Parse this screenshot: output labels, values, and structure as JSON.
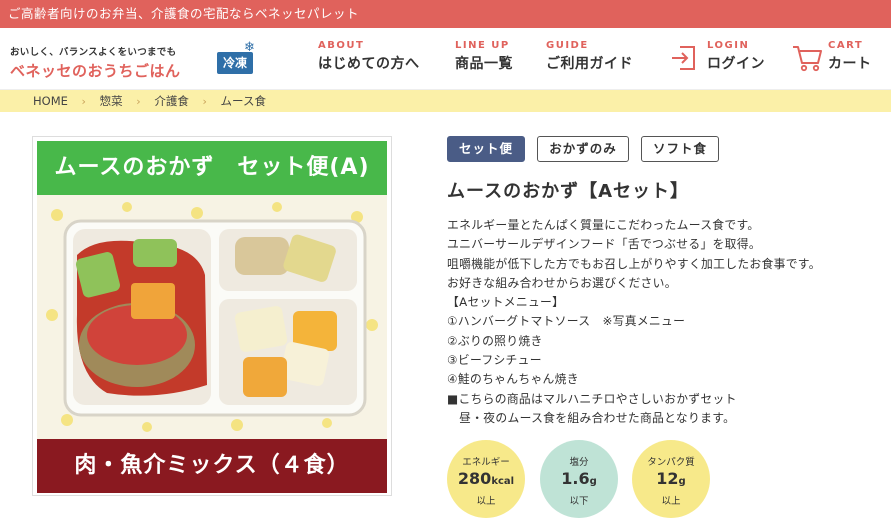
{
  "top_banner": "ご高齢者向けのお弁当、介護食の宅配ならベネッセパレット",
  "logo": {
    "tagline": "おいしく、バランスよくをいつまでも",
    "name": "ベネッセのおうちごはん",
    "badge": "冷凍"
  },
  "nav": [
    {
      "en": "ABOUT",
      "ja": "はじめての方へ"
    },
    {
      "en": "LINE UP",
      "ja": "商品一覧"
    },
    {
      "en": "GUIDE",
      "ja": "ご利用ガイド"
    },
    {
      "en": "LOGIN",
      "ja": "ログイン",
      "icon": "login-icon"
    },
    {
      "en": "CART",
      "ja": "カート",
      "icon": "cart-icon"
    }
  ],
  "breadcrumb": [
    "HOME",
    "惣菜",
    "介護食",
    "ムース食"
  ],
  "product_image": {
    "top_label": "ムースのおかず　セット便(A)",
    "bottom_label": "肉・魚介ミックス（４食）"
  },
  "tags": [
    "セット便",
    "おかずのみ",
    "ソフト食"
  ],
  "title": "ムースのおかず【Aセット】",
  "description": [
    "エネルギー量とたんぱく質量にこだわったムース食です。",
    "ユニバーサールデザインフード「舌でつぶせる」を取得。",
    "咀嚼機能が低下した方でもお召し上がりやすく加工したお食事です。",
    "お好きな組み合わせからお選びください。",
    "【Aセットメニュー】",
    "①ハンバーグトマトソース　※写真メニュー",
    "②ぶりの照り焼き",
    "③ビーフシチュー",
    "④鮭のちゃんちゃん焼き",
    "■こちらの商品はマルハニチロやさしいおかずセット",
    "　昼・夜のムース食を組み合わせた商品となります。"
  ],
  "nutrition": [
    {
      "label": "エネルギー",
      "value": "280",
      "unit": "kcal",
      "cond": "以上",
      "color": "#f7e98a"
    },
    {
      "label": "塩分",
      "value": "1.6",
      "unit": "g",
      "cond": "以下",
      "color": "#bfe3d6"
    },
    {
      "label": "タンパク質",
      "value": "12",
      "unit": "g",
      "cond": "以上",
      "color": "#f7e98a"
    }
  ],
  "colors": {
    "brand": "#e0625c",
    "breadcrumb_bg": "#fbf0a8",
    "tag_active": "#4a5c86",
    "image_top_banner": "#48b84a",
    "image_bottom_banner": "#8a1920"
  }
}
